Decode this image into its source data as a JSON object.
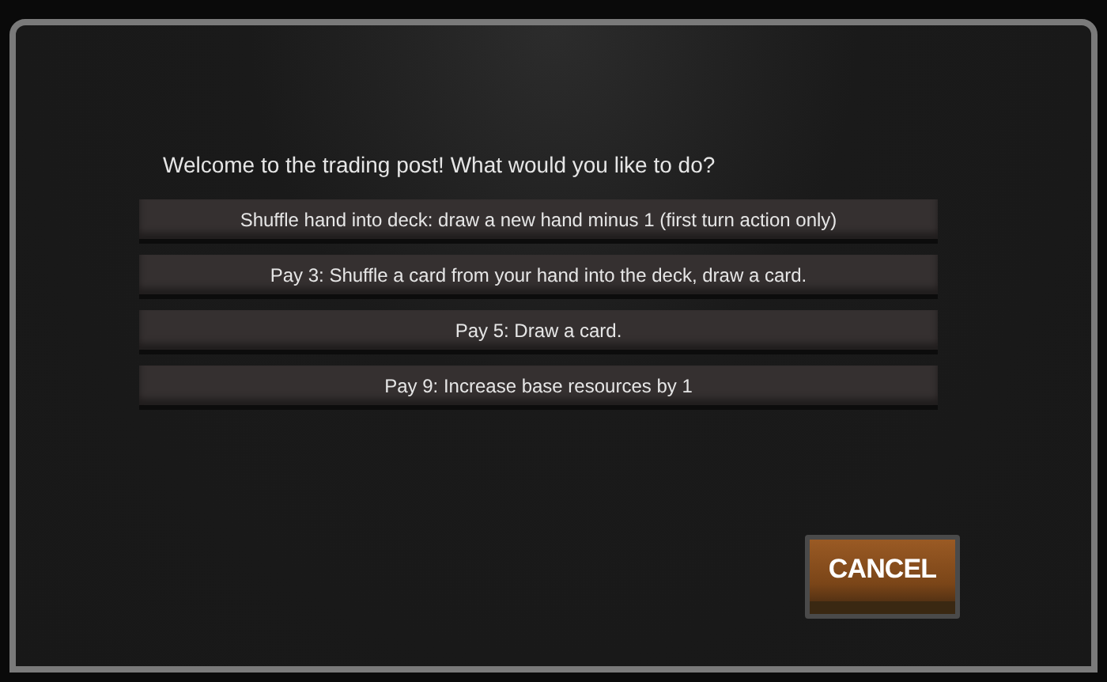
{
  "prompt": "Welcome to the trading post! What would you like to do?",
  "options": [
    {
      "label": "Shuffle hand into deck: draw a new hand minus 1 (first turn action only)"
    },
    {
      "label": "Pay 3: Shuffle a card from your hand into the deck, draw a card."
    },
    {
      "label": "Pay 5: Draw a card."
    },
    {
      "label": "Pay 9: Increase base resources by 1"
    }
  ],
  "cancel_button": "CANCEL"
}
